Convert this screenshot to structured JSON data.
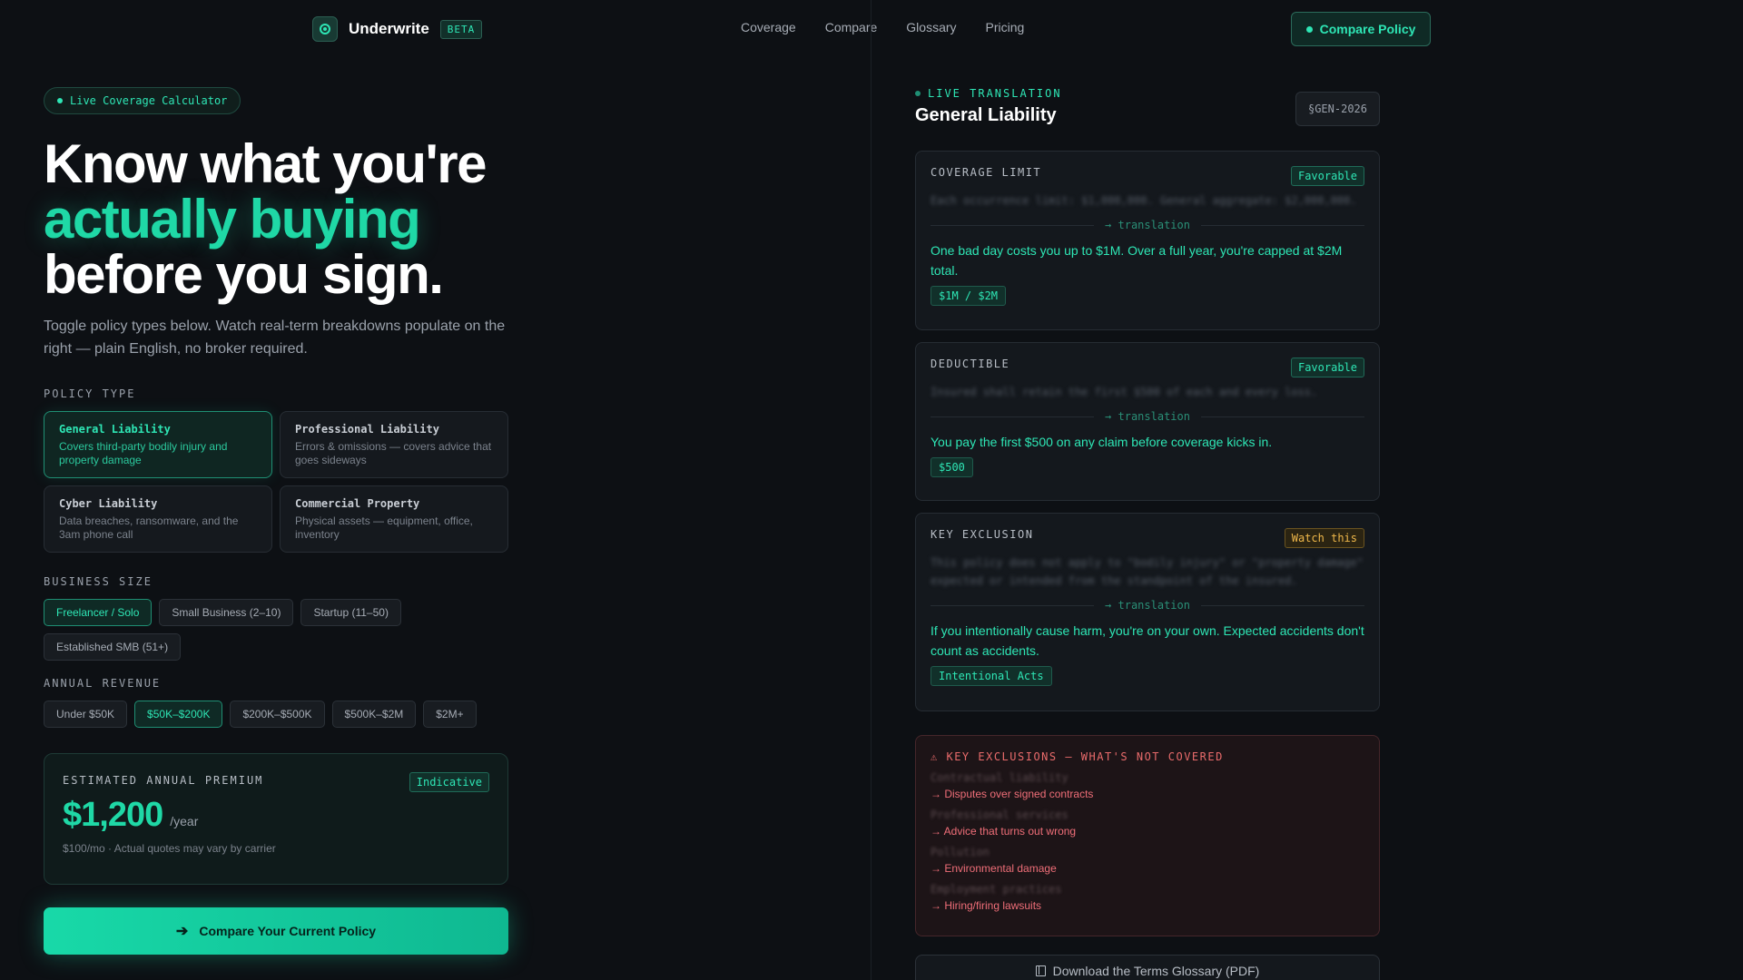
{
  "header": {
    "brand": "Underwrite",
    "beta": "BETA",
    "nav": [
      "Coverage",
      "Compare",
      "Glossary",
      "Pricing"
    ],
    "compare_button": "Compare Policy"
  },
  "hero": {
    "pill": "Live Coverage Calculator",
    "line1": "Know what you're",
    "line2": "actually buying",
    "line3": "before you sign.",
    "subtitle": "Toggle policy types below. Watch real-term breakdowns populate on the right — plain English, no broker required."
  },
  "policy_type": {
    "label": "POLICY TYPE",
    "selected": "General Liability",
    "options": [
      {
        "title": "General Liability",
        "desc": "Covers third-party bodily injury and property damage"
      },
      {
        "title": "Professional Liability",
        "desc": "Errors & omissions — covers advice that goes sideways"
      },
      {
        "title": "Cyber Liability",
        "desc": "Data breaches, ransomware, and the 3am phone call"
      },
      {
        "title": "Commercial Property",
        "desc": "Physical assets — equipment, office, inventory"
      }
    ]
  },
  "business_size": {
    "label": "BUSINESS SIZE",
    "selected": "Freelancer / Solo",
    "options": [
      "Freelancer / Solo",
      "Small Business (2–10)",
      "Startup (11–50)",
      "Established SMB (51+)"
    ]
  },
  "annual_revenue": {
    "label": "ANNUAL REVENUE",
    "selected": "$50K–$200K",
    "options": [
      "Under $50K",
      "$50K–$200K",
      "$200K–$500K",
      "$500K–$2M",
      "$2M+"
    ]
  },
  "premium": {
    "label": "ESTIMATED ANNUAL PREMIUM",
    "badge": "Indicative",
    "price": "$1,200",
    "per": "/year",
    "note": "$100/mo · Actual quotes may vary by carrier"
  },
  "cta": {
    "label": "Compare Your Current Policy"
  },
  "translation": {
    "live_label": "LIVE TRANSLATION",
    "title": "General Liability",
    "code": "§GEN-2026",
    "separator": "→ translation",
    "terms": [
      {
        "title": "COVERAGE LIMIT",
        "badge": "Favorable",
        "legal": "Each occurrence limit: $1,000,000. General aggregate: $2,000,000.",
        "plain": "One bad day costs you up to $1M. Over a full year, you're capped at $2M total.",
        "tag": "$1M / $2M"
      },
      {
        "title": "DEDUCTIBLE",
        "badge": "Favorable",
        "legal": "Insured shall retain the first $500 of each and every loss.",
        "plain": "You pay the first $500 on any claim before coverage kicks in.",
        "tag": "$500"
      },
      {
        "title": "KEY EXCLUSION",
        "badge": "Watch this",
        "legal": "This policy does not apply to \"bodily injury\" or \"property damage\" expected or intended from the standpoint of the insured.",
        "plain": "If you intentionally cause harm, you're on your own. Expected accidents don't count as accidents.",
        "tag": "Intentional Acts"
      }
    ]
  },
  "exclusions": {
    "title": "KEY EXCLUSIONS — WHAT'S NOT COVERED",
    "items": [
      {
        "legal": "Contractual liability",
        "plain": "→ Disputes over signed contracts"
      },
      {
        "legal": "Professional services",
        "plain": "→ Advice that turns out wrong"
      },
      {
        "legal": "Pollution",
        "plain": "→ Environmental damage"
      },
      {
        "legal": "Employment practices",
        "plain": "→ Hiring/firing lawsuits"
      }
    ]
  },
  "download": {
    "label": "Download the Terms Glossary (PDF)"
  },
  "colors": {
    "accent": "#1fd8a6",
    "warning": "#f0b84a",
    "danger": "#ef6e78",
    "background": "#0d1014"
  },
  "icons": {
    "logo": "shield-icon",
    "cta": "arrow-right-icon",
    "exclusions": "warning-icon",
    "download": "book-icon"
  }
}
